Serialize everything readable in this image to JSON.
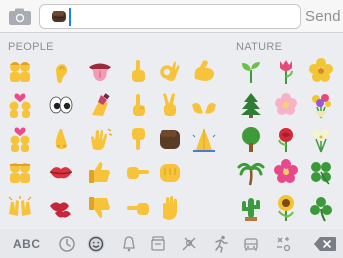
{
  "input_bar": {
    "camera_icon": "camera-icon",
    "typed_emoji": "fist-dark-skin-emoji",
    "send_label": "Send"
  },
  "keyboard": {
    "sections": [
      {
        "label": "PEOPLE"
      },
      {
        "label": "NATURE"
      }
    ],
    "people_emojis": [
      "two-women-emoji",
      "ear-emoji",
      "tongue-emoji",
      "pointing-up-emoji",
      "ok-hand-emoji",
      "flexed-biceps-emoji",
      "couple-with-heart-emoji",
      "eyes-emoji",
      "nail-polish-emoji",
      "index-pointing-up-emoji",
      "victory-hand-emoji",
      "open-hands-emoji",
      "kiss-couple-emoji",
      "nose-emoji",
      "waving-hand-emoji",
      "pointing-down-emoji",
      "raised-fist-dark-emoji",
      "folded-hands-emoji",
      "two-men-emoji",
      "lips-emoji",
      "thumbs-up-emoji",
      "pointing-right-emoji",
      "oncoming-fist-emoji",
      "",
      "raising-hands-emoji",
      "kiss-mark-emoji",
      "thumbs-down-emoji",
      "pointing-left-emoji",
      "raised-hand-emoji",
      ""
    ],
    "nature_emojis": [
      "seedling-emoji",
      "tulip-emoji",
      "blossom-emoji",
      "evergreen-tree-emoji",
      "cherry-blossom-emoji",
      "bouquet-emoji",
      "deciduous-tree-emoji",
      "rose-emoji",
      "bouquet-white-emoji",
      "palm-tree-emoji",
      "hibiscus-emoji",
      "four-leaf-clover-emoji",
      "cactus-emoji",
      "sunflower-emoji",
      "shamrock-emoji"
    ]
  },
  "bottom_bar": {
    "abc_label": "ABC",
    "categories": [
      {
        "name": "recent-icon"
      },
      {
        "name": "smiley-icon",
        "selected": true
      },
      {
        "name": "bell-icon"
      },
      {
        "name": "flower-icon"
      },
      {
        "name": "travel-icon"
      },
      {
        "name": "sports-icon"
      },
      {
        "name": "car-icon"
      },
      {
        "name": "symbols-icon"
      }
    ],
    "delete_icon": "delete-icon"
  },
  "colors": {
    "keyboard_bg": "#ebedf0",
    "label_gray": "#8a8f96",
    "caret_blue": "#1a7cff",
    "emoji_yellow": "#f6c33b"
  }
}
